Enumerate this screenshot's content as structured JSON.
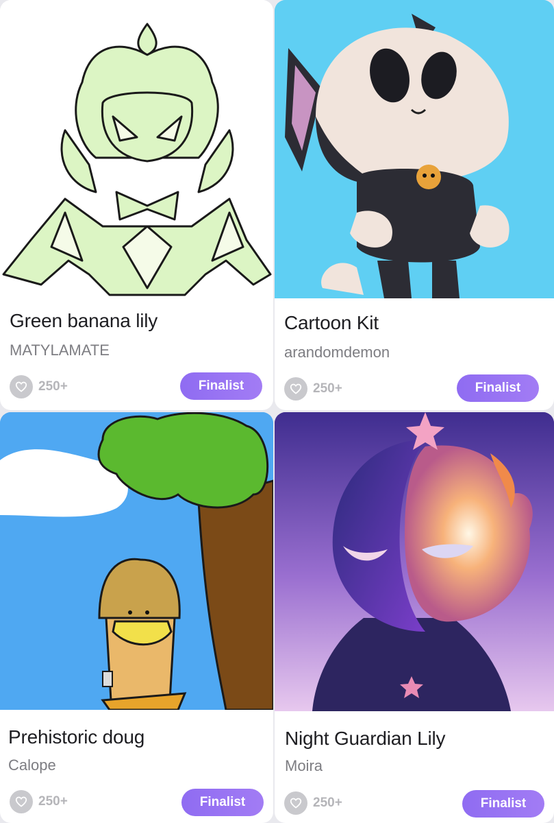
{
  "cards": [
    {
      "title": "Green banana lily",
      "author": "MATYLAMATE",
      "likes": "250+",
      "badge": "Finalist",
      "image_desc": "green-lily-drawing"
    },
    {
      "title": "Cartoon Kit",
      "author": "arandomdemon",
      "likes": "250+",
      "badge": "Finalist",
      "image_desc": "cartoon-cat-render"
    },
    {
      "title": "Prehistoric doug",
      "author": "Calope",
      "likes": "250+",
      "badge": "Finalist",
      "image_desc": "doug-under-tree-drawing"
    },
    {
      "title": "Night Guardian Lily",
      "author": "Moira",
      "likes": "250+",
      "badge": "Finalist",
      "image_desc": "night-sun-face-drawing"
    }
  ],
  "icons": {
    "like": "heart-icon"
  },
  "colors": {
    "accent": "#9b75f3",
    "card_bg": "#ffffff",
    "page_bg": "#e9e9ee"
  }
}
